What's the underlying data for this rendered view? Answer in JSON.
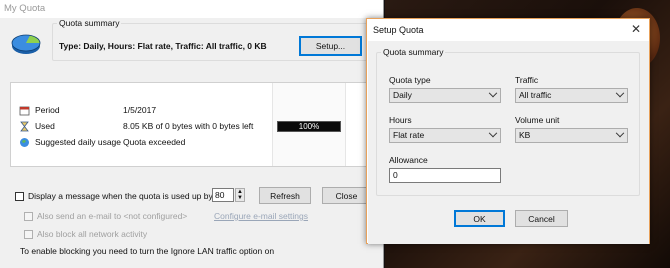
{
  "main_window": {
    "title": "My Quota",
    "summary": {
      "group_label": "Quota summary",
      "text": "Type: Daily, Hours: Flat rate, Traffic: All traffic, 0 KB",
      "setup_button": "Setup..."
    },
    "info": {
      "period_label": "Period",
      "period_value": "1/5/2017",
      "used_label": "Used",
      "used_value": "8.05 KB of 0 bytes with 0 bytes left",
      "used_percent": 100,
      "used_percent_text": "100%",
      "suggested_label": "Suggested daily usage",
      "suggested_value": "Quota exceeded"
    },
    "options": {
      "display_message_label": "Display a message when the quota is used up by, %",
      "display_message_checked": false,
      "percent_value": "80",
      "email_label": "Also send an e-mail to <not configured>",
      "email_checked": false,
      "email_link": "Configure e-mail settings",
      "block_label": "Also block all network activity",
      "block_checked": false,
      "footer_note": "To enable blocking you need to turn the Ignore LAN traffic option on"
    },
    "refresh_button": "Refresh",
    "close_button": "Close"
  },
  "setup_dialog": {
    "title": "Setup Quota",
    "group_label": "Quota summary",
    "quota_type_label": "Quota type",
    "quota_type_value": "Daily",
    "traffic_label": "Traffic",
    "traffic_value": "All traffic",
    "hours_label": "Hours",
    "hours_value": "Flat rate",
    "volume_unit_label": "Volume unit",
    "volume_unit_value": "KB",
    "allowance_label": "Allowance",
    "allowance_value": "0",
    "ok_button": "OK",
    "cancel_button": "Cancel"
  },
  "colors": {
    "accent_border": "#e8a15a",
    "focus_blue": "#0078d7",
    "progress_fill": "#0a0a0a"
  }
}
